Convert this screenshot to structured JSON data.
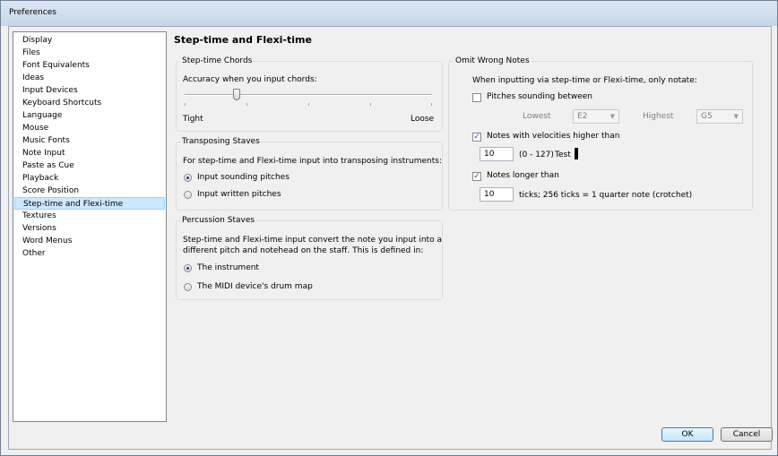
{
  "window": {
    "title": "Preferences"
  },
  "sidebar": {
    "items": [
      "Display",
      "Files",
      "Font Equivalents",
      "Ideas",
      "Input Devices",
      "Keyboard Shortcuts",
      "Language",
      "Mouse",
      "Music Fonts",
      "Note Input",
      "Paste as Cue",
      "Playback",
      "Score Position",
      "Step-time and Flexi-time",
      "Textures",
      "Versions",
      "Word Menus",
      "Other"
    ],
    "selected": "Step-time and Flexi-time"
  },
  "page": {
    "title": "Step-time and Flexi-time"
  },
  "chords": {
    "label": "Step-time Chords",
    "accuracy_label": "Accuracy when you input chords:",
    "slider_value_percent": 21,
    "min_label": "Tight",
    "max_label": "Loose"
  },
  "transposing": {
    "label": "Transposing Staves",
    "desc": "For step-time and Flexi-time input into transposing instruments:",
    "opt1": "Input sounding pitches",
    "opt2": "Input written pitches",
    "selected": "Input sounding pitches"
  },
  "percussion": {
    "label": "Percussion Staves",
    "desc1": "Step-time and Flexi-time input convert the note you input into a",
    "desc2": "different pitch and notehead on the staff. This is defined in:",
    "opt1": "The instrument",
    "opt2": "The MIDI device's drum map",
    "selected": "The instrument"
  },
  "omit": {
    "label": "Omit Wrong Notes",
    "desc": "When inputting via step-time or Flexi-time, only notate:",
    "pitches_label": "Pitches sounding between",
    "pitches_checked": false,
    "lowest_label": "Lowest",
    "lowest_value": "E2",
    "highest_label": "Highest",
    "highest_value": "G5",
    "velocity_label": "Notes with velocities higher than",
    "velocity_checked": true,
    "velocity_value": "10",
    "velocity_range": "(0 - 127)",
    "test_label": "Test",
    "longer_label": "Notes longer than",
    "longer_checked": true,
    "longer_value": "10",
    "ticks_text": "ticks; 256 ticks = 1 quarter note (crotchet)"
  },
  "buttons": {
    "ok": "OK",
    "cancel": "Cancel"
  },
  "icons": {
    "check_mark": "✓",
    "dropdown_arrow": "▼"
  }
}
